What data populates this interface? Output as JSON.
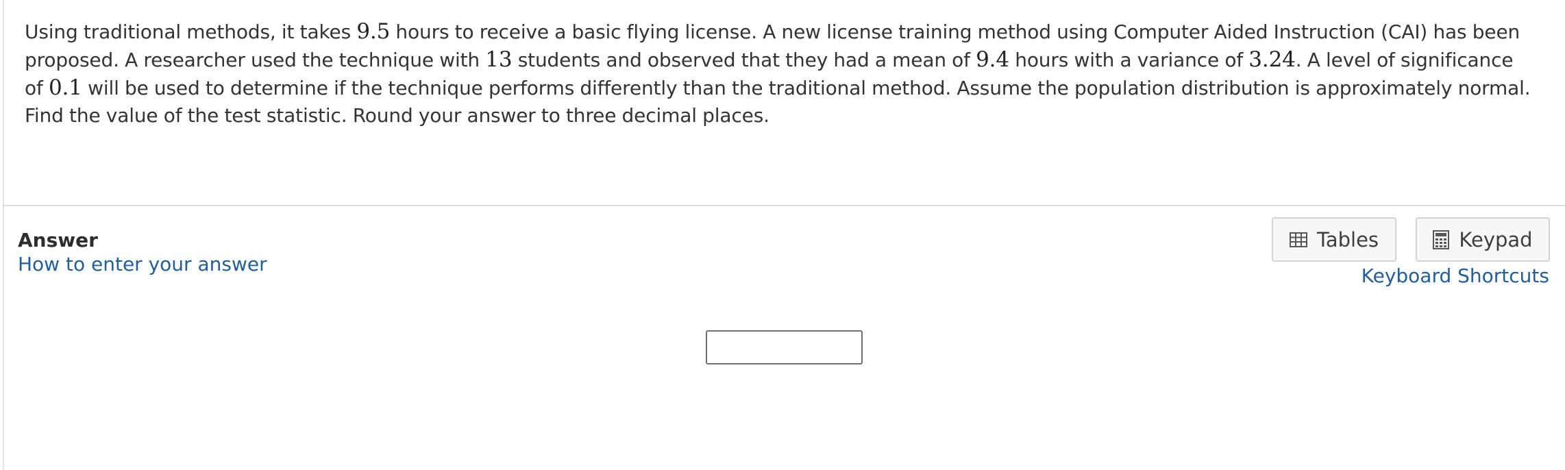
{
  "question": {
    "segments": [
      "Using traditional methods, it takes ",
      "9.5",
      " hours to receive a basic flying license.  A new license training method using Computer Aided Instruction (CAI) has been proposed. A researcher used the technique with ",
      "13",
      " students and observed that they had a mean of ",
      "9.4",
      " hours with a variance of ",
      "3.24",
      ".  A level of significance of ",
      "0.1",
      " will be used to determine if the technique performs differently than the traditional method.  Assume the population distribution is approximately normal.  Find the value of the test statistic.  Round your answer to three decimal places."
    ]
  },
  "answer": {
    "title": "Answer",
    "how_to_link": "How to enter your answer",
    "input_value": ""
  },
  "tools": {
    "tables_label": "Tables",
    "tables_icon": "table-icon",
    "keypad_label": "Keypad",
    "keypad_icon": "calculator-icon",
    "shortcuts_link": "Keyboard Shortcuts"
  },
  "colors": {
    "link": "#1f5fa0",
    "text": "#333333",
    "button_bg": "#f7f7f7",
    "button_border": "#d3d3d3",
    "divider": "#dedede"
  }
}
